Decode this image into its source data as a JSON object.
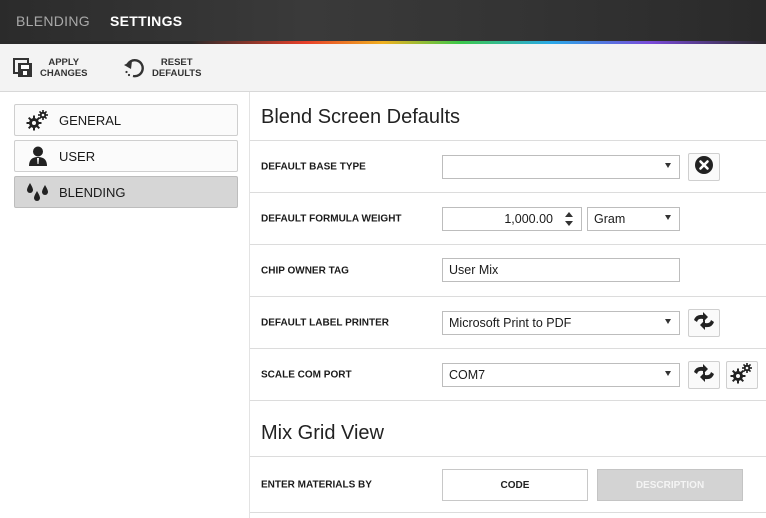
{
  "topbar": {
    "tab_blending": "BLENDING",
    "tab_settings": "SETTINGS"
  },
  "toolbar": {
    "apply_line1": "APPLY",
    "apply_line2": "CHANGES",
    "reset_line1": "RESET",
    "reset_line2": "DEFAULTS"
  },
  "sidebar": {
    "items": [
      {
        "label": "GENERAL",
        "icon": "gears-icon"
      },
      {
        "label": "USER",
        "icon": "user-icon"
      },
      {
        "label": "BLENDING",
        "icon": "drops-icon",
        "active": true
      }
    ]
  },
  "blend_defaults": {
    "title": "Blend Screen Defaults",
    "base_type": {
      "label": "DEFAULT BASE TYPE",
      "value": ""
    },
    "formula_weight": {
      "label": "DEFAULT FORMULA WEIGHT",
      "value": "1,000.00",
      "unit": "Gram"
    },
    "chip_owner": {
      "label": "CHIP OWNER TAG",
      "value": "User Mix"
    },
    "label_printer": {
      "label": "DEFAULT LABEL PRINTER",
      "value": "Microsoft Print to PDF"
    },
    "scale_port": {
      "label": "SCALE COM PORT",
      "value": "COM7"
    }
  },
  "mix_grid": {
    "title": "Mix Grid View",
    "enter_by": {
      "label": "ENTER MATERIALS BY",
      "option_code": "CODE",
      "option_description": "DESCRIPTION",
      "selected": "CODE"
    }
  },
  "colors": {
    "topbar": "#333333",
    "active_nav": "#d6d6d6",
    "disabled_toggle": "#d3d3d3"
  }
}
